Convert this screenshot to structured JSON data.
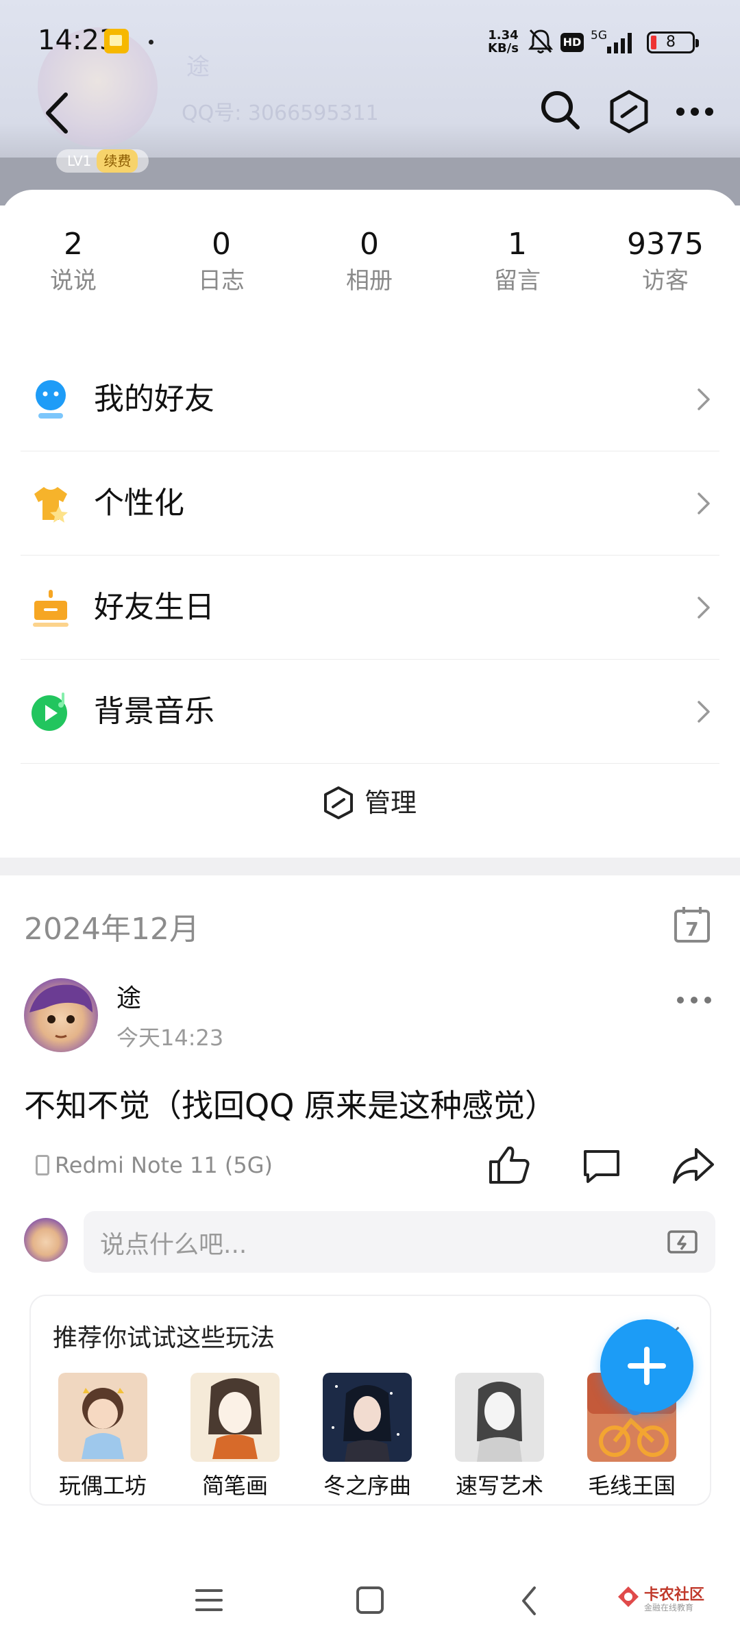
{
  "status_bar": {
    "time": "14:23",
    "speed_top": "1.34",
    "speed_bottom": "KB/s",
    "hd": "HD",
    "network": "5G",
    "battery": "8"
  },
  "profile": {
    "level": "LV1",
    "renew": "续费",
    "name_ghost": "途",
    "qq_ghost": "QQ号: 3066595311"
  },
  "stats": [
    {
      "value": "2",
      "label": "说说"
    },
    {
      "value": "0",
      "label": "日志"
    },
    {
      "value": "0",
      "label": "相册"
    },
    {
      "value": "1",
      "label": "留言"
    },
    {
      "value": "9375",
      "label": "访客"
    }
  ],
  "menu": [
    {
      "label": "我的好友",
      "icon": "friends-icon",
      "color": "#1e9cf7"
    },
    {
      "label": "个性化",
      "icon": "tshirt-star-icon",
      "color": "#f6b32b"
    },
    {
      "label": "好友生日",
      "icon": "birthday-cake-icon",
      "color": "#f6a623"
    },
    {
      "label": "背景音乐",
      "icon": "music-play-icon",
      "color": "#22c55e"
    }
  ],
  "manage_label": "管理",
  "feed": {
    "month": "2024年12月",
    "post": {
      "author": "途",
      "time": "今天14:23",
      "text": "不知不觉（找回QQ 原来是这种感觉）",
      "device": "Redmi Note 11 (5G)"
    },
    "comment_placeholder": "说点什么吧..."
  },
  "recommend": {
    "title": "推荐你试试这些玩法",
    "close": "×",
    "items": [
      {
        "label": "玩偶工坊",
        "color": "#e8b98a"
      },
      {
        "label": "简笔画",
        "color": "#e9d4b8"
      },
      {
        "label": "冬之序曲",
        "color": "#2b3a5a"
      },
      {
        "label": "速写艺术",
        "color": "#d8d8d8"
      },
      {
        "label": "毛线王国",
        "color": "#d7805a"
      }
    ]
  },
  "watermark": {
    "title": "卡农社区",
    "subtitle": "金融在线教育"
  }
}
